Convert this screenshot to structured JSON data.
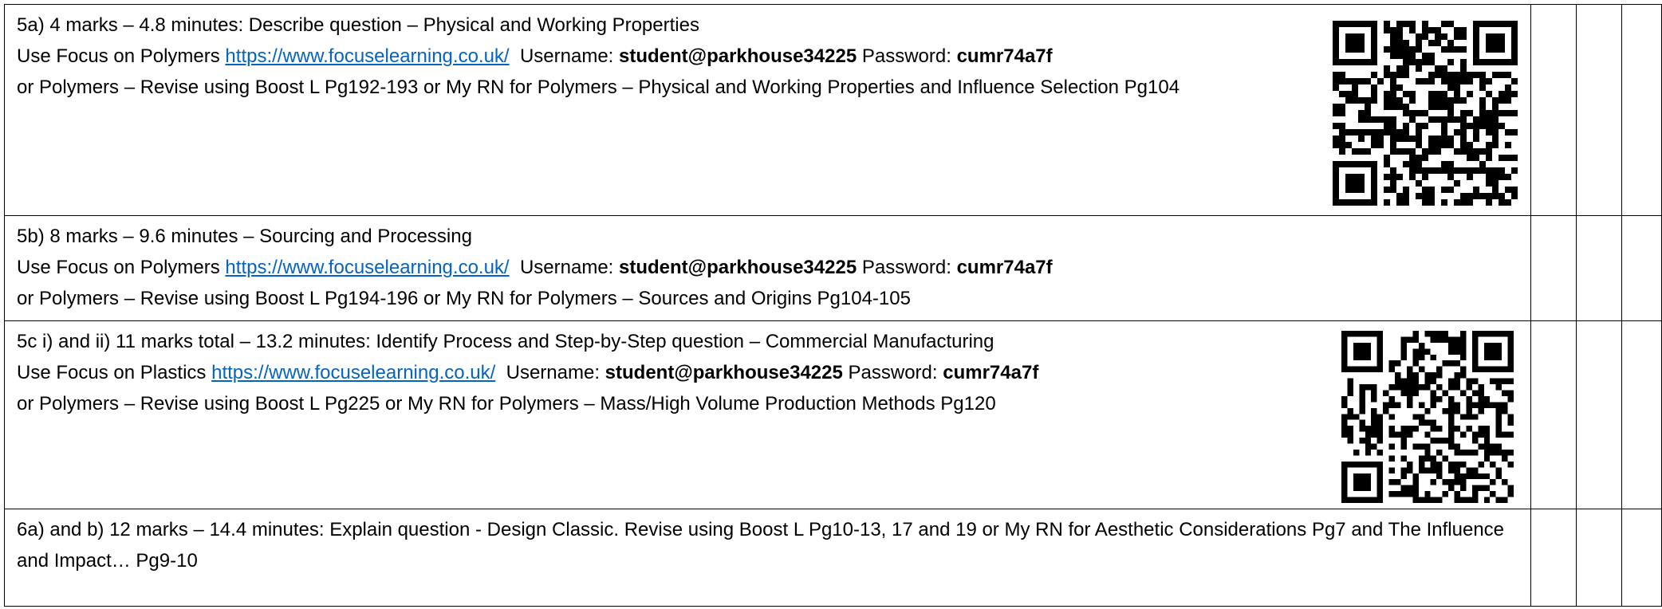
{
  "rows": [
    {
      "heading": "5a) 4 marks – 4.8 minutes: Describe question – Physical and Working Properties",
      "focus_prefix": "Use Focus on Polymers ",
      "link": "https://www.focuselearning.co.uk/",
      "username_label": "Username: ",
      "username": "student@parkhouse34225",
      "password_label": " Password: ",
      "password": "cumr74a7f",
      "revise": "or Polymers – Revise using Boost L Pg192-193 or My RN for Polymers – Physical and Working Properties and Influence Selection Pg104",
      "qr_icon": "qr-code-icon"
    },
    {
      "heading": "5b) 8 marks – 9.6 minutes – Sourcing and Processing",
      "focus_prefix": "Use Focus on Polymers ",
      "link": "https://www.focuselearning.co.uk/",
      "username_label": "Username: ",
      "username": "student@parkhouse34225",
      "password_label": " Password: ",
      "password": "cumr74a7f",
      "revise": "or Polymers – Revise using Boost L Pg194-196 or My RN for Polymers – Sources and Origins Pg104-105"
    },
    {
      "heading": "5c i) and ii) 11 marks total – 13.2 minutes: Identify Process and Step-by-Step question – Commercial Manufacturing",
      "focus_prefix": "Use Focus on Plastics ",
      "link": "https://www.focuselearning.co.uk/",
      "username_label": "Username: ",
      "username": "student@parkhouse34225",
      "password_label": " Password: ",
      "password": "cumr74a7f",
      "revise": "or Polymers – Revise using Boost L Pg225 or My RN for Polymers – Mass/High Volume Production Methods Pg120",
      "qr_icon": "qr-code-icon"
    },
    {
      "text": "6a) and b) 12 marks – 14.4 minutes: Explain question - Design Classic. Revise using Boost L Pg10-13, 17 and 19 or My RN for Aesthetic Considerations Pg7 and The Influence and Impact… Pg9-10"
    }
  ]
}
